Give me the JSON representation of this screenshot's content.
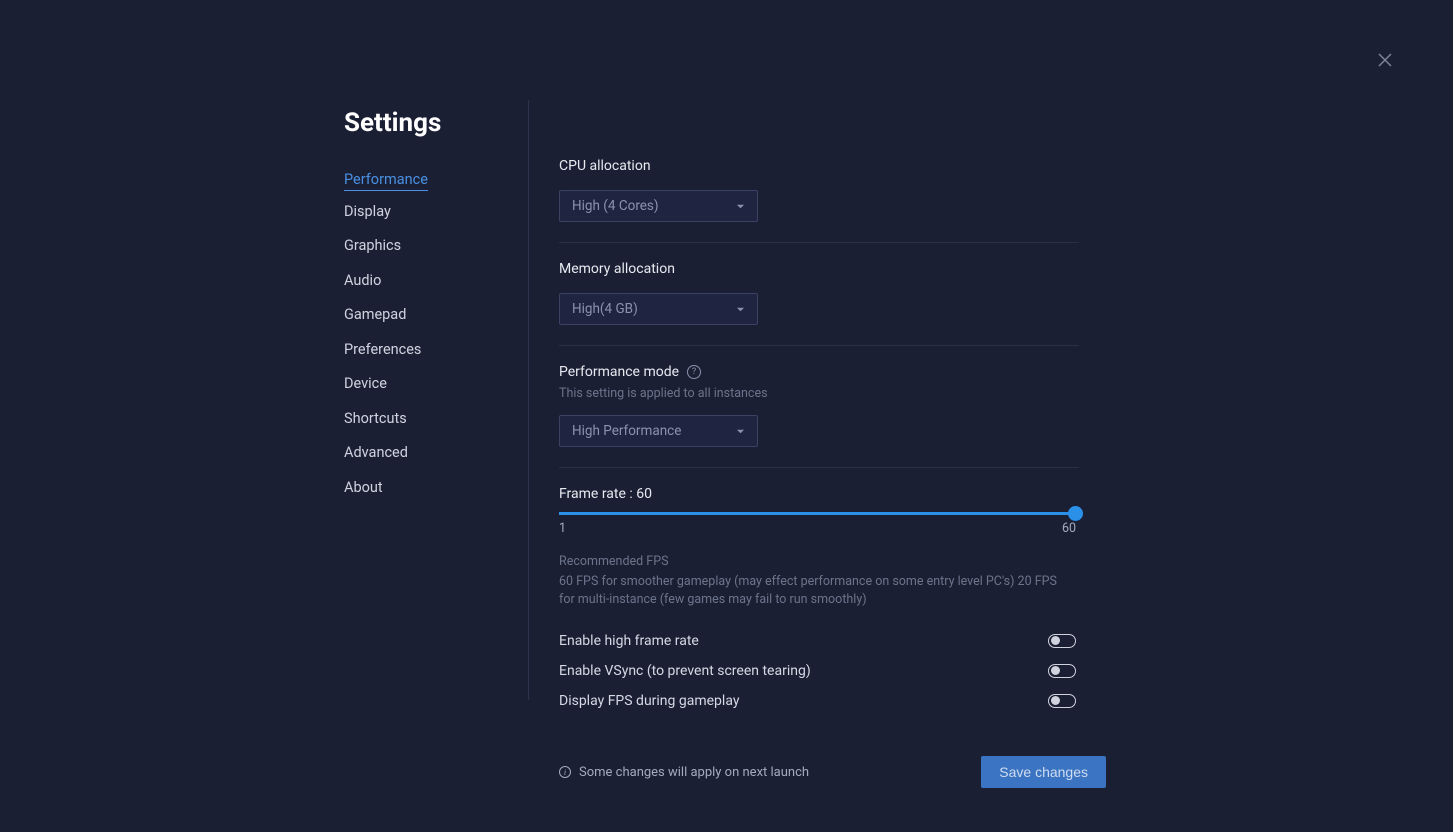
{
  "page": {
    "title": "Settings"
  },
  "sidebar": {
    "items": [
      {
        "label": "Performance",
        "active": true
      },
      {
        "label": "Display"
      },
      {
        "label": "Graphics"
      },
      {
        "label": "Audio"
      },
      {
        "label": "Gamepad"
      },
      {
        "label": "Preferences"
      },
      {
        "label": "Device"
      },
      {
        "label": "Shortcuts"
      },
      {
        "label": "Advanced"
      },
      {
        "label": "About"
      }
    ]
  },
  "cpu": {
    "label": "CPU allocation",
    "value": "High (4 Cores)"
  },
  "memory": {
    "label": "Memory allocation",
    "value": "High(4 GB)"
  },
  "perfmode": {
    "label": "Performance mode",
    "sublabel": "This setting is applied to all instances",
    "value": "High Performance"
  },
  "framerate": {
    "label_prefix": "Frame rate : ",
    "value": "60",
    "min": "1",
    "max": "60",
    "rec_title": "Recommended FPS",
    "rec_text": "60 FPS for smoother gameplay (may effect performance on some entry level PC's) 20 FPS for multi-instance (few games may fail to run smoothly)"
  },
  "toggles": {
    "high_frame": {
      "label": "Enable high frame rate"
    },
    "vsync": {
      "label": "Enable VSync (to prevent screen tearing)"
    },
    "display_fps": {
      "label": "Display FPS during gameplay"
    }
  },
  "footer": {
    "message": "Some changes will apply on next launch",
    "save_label": "Save changes"
  }
}
